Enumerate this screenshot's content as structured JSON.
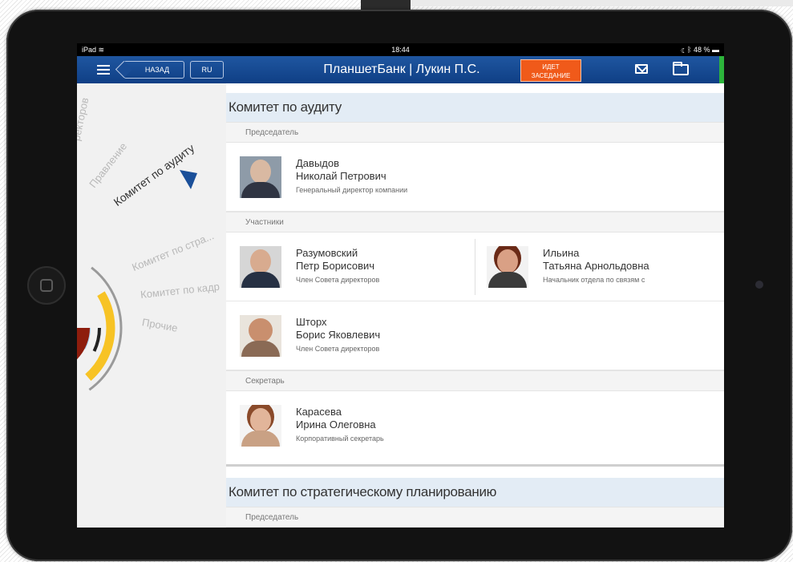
{
  "statusbar": {
    "device": "iPad",
    "time": "18:44",
    "battery": "48 %"
  },
  "navbar": {
    "back_label": "НАЗАД",
    "lang_label": "RU",
    "title": "ПланшетБанк | Лукин П.С.",
    "meeting_line1": "ИДЕТ",
    "meeting_line2": "ЗАСЕДАНИЕ"
  },
  "sidebar": {
    "items": [
      {
        "label": "ректоров"
      },
      {
        "label": "Правление"
      },
      {
        "label": "Комитет по аудиту"
      },
      {
        "label": "Комитет по стра..."
      },
      {
        "label": "Комитет по кадр"
      },
      {
        "label": "Прочие"
      }
    ]
  },
  "committees": [
    {
      "title": "Комитет по аудиту",
      "sections": {
        "chair": "Председатель",
        "members": "Участники",
        "secretary": "Секретарь"
      },
      "chair": {
        "surname": "Давыдов",
        "name": "Николай Петрович",
        "role": "Генеральный директор компании"
      },
      "members": [
        {
          "surname": "Разумовский",
          "name": "Петр Борисович",
          "role": "Член Совета директоров"
        },
        {
          "surname": "Ильина",
          "name": "Татьяна Арнольдовна",
          "role": "Начальник отдела по связям с"
        },
        {
          "surname": "Шторх",
          "name": "Борис Яковлевич",
          "role": "Член Совета директоров"
        }
      ],
      "secretary": {
        "surname": "Карасева",
        "name": "Ирина Олеговна",
        "role": "Корпоративный секретарь"
      }
    },
    {
      "title": "Комитет по стратегическому планированию",
      "sections": {
        "chair": "Председатель"
      }
    }
  ],
  "colors": {
    "nav_blue": "#1a4f99",
    "meeting_orange": "#f05a1a",
    "header_bg": "#e3ecf5",
    "active_arrow": "#1a4f99"
  }
}
